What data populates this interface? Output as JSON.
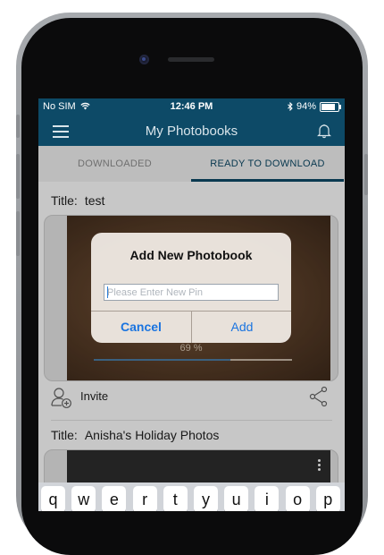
{
  "status_bar": {
    "carrier": "No SIM",
    "time": "12:46 PM",
    "battery": "94%",
    "battery_level": 0.94
  },
  "navbar": {
    "title": "My Photobooks",
    "menu_icon": "hamburger-icon",
    "bell_icon": "bell-icon"
  },
  "tabs": [
    {
      "label": "DOWNLOADED",
      "active": false
    },
    {
      "label": "READY TO DOWNLOAD",
      "active": true
    }
  ],
  "books": [
    {
      "title_label": "Title:",
      "title": "test",
      "progress_text": "69 %",
      "progress": 0.69
    },
    {
      "title_label": "Title:",
      "title": "Anisha's Holiday Photos"
    }
  ],
  "invite": {
    "label": "Invite",
    "icon": "add-user-icon",
    "share_icon": "share-icon"
  },
  "dialog": {
    "title": "Add New Photobook",
    "placeholder": "Please Enter New Pin",
    "value": "",
    "cancel_label": "Cancel",
    "add_label": "Add"
  },
  "keyboard": {
    "keys": [
      "q",
      "w",
      "e",
      "r",
      "t",
      "y",
      "u",
      "i",
      "o",
      "p"
    ]
  },
  "colors": {
    "brand": "#0d4a67",
    "action_blue": "#1a74e0"
  }
}
